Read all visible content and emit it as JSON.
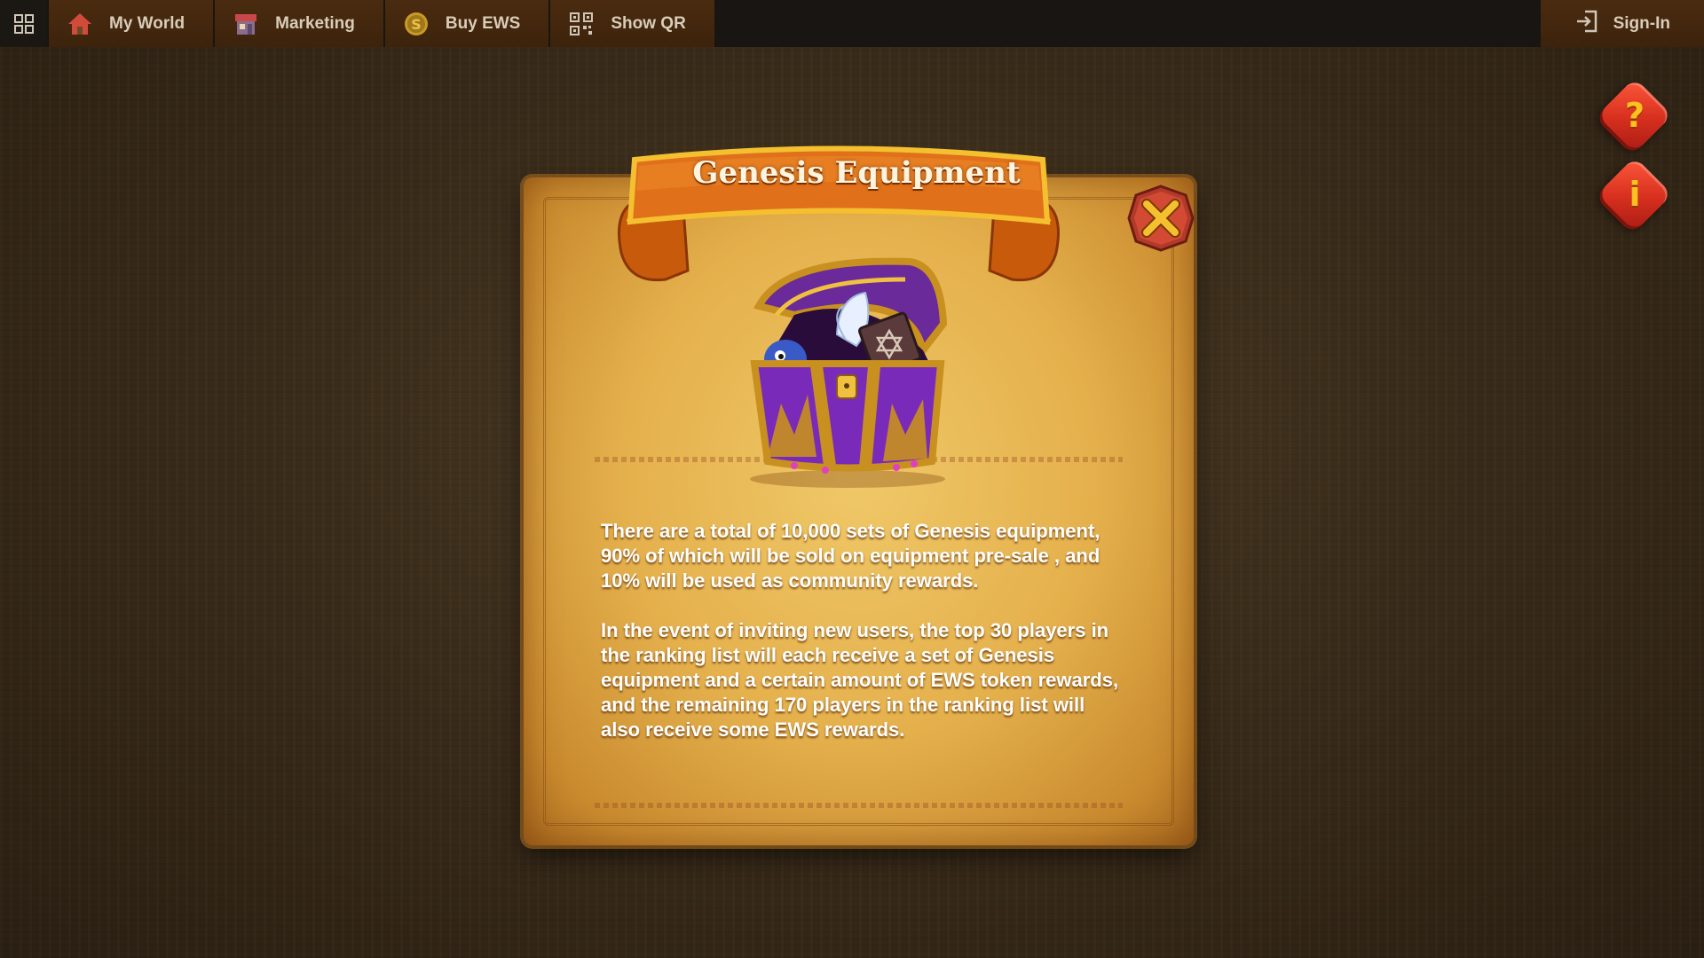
{
  "topbar": {
    "menu_icon": "grid-icon",
    "nav": [
      {
        "label": "My World",
        "icon": "house-icon"
      },
      {
        "label": "Marketing",
        "icon": "shop-icon"
      },
      {
        "label": "Buy EWS",
        "icon": "coin-icon"
      },
      {
        "label": "Show QR",
        "icon": "qr-icon"
      }
    ],
    "signin": {
      "label": "Sign-In",
      "icon": "sign-in-icon"
    }
  },
  "side_buttons": [
    {
      "glyph": "?",
      "icon": "help-icon"
    },
    {
      "glyph": "i",
      "icon": "info-icon"
    }
  ],
  "dialog": {
    "title": "Genesis Equipment",
    "paragraphs": [
      "There are a total of 10,000 sets of Genesis equipment, 90% of which will be sold on equipment pre-sale , and 10% will be used as community rewards.",
      "In the event of inviting new users, the top 30 players in the ranking list will each receive a set of Genesis equipment and a certain amount of EWS token rewards, and the remaining 170 players in the ranking list will also receive some EWS rewards."
    ],
    "image_icon": "treasure-chest-icon",
    "close_icon": "close-icon"
  },
  "colors": {
    "topbar_bg": "#181512",
    "nav_bg": "#4a2b10",
    "accent_red": "#d62f1e",
    "banner_orange": "#e06a10",
    "parchment": "#e4b04c"
  }
}
